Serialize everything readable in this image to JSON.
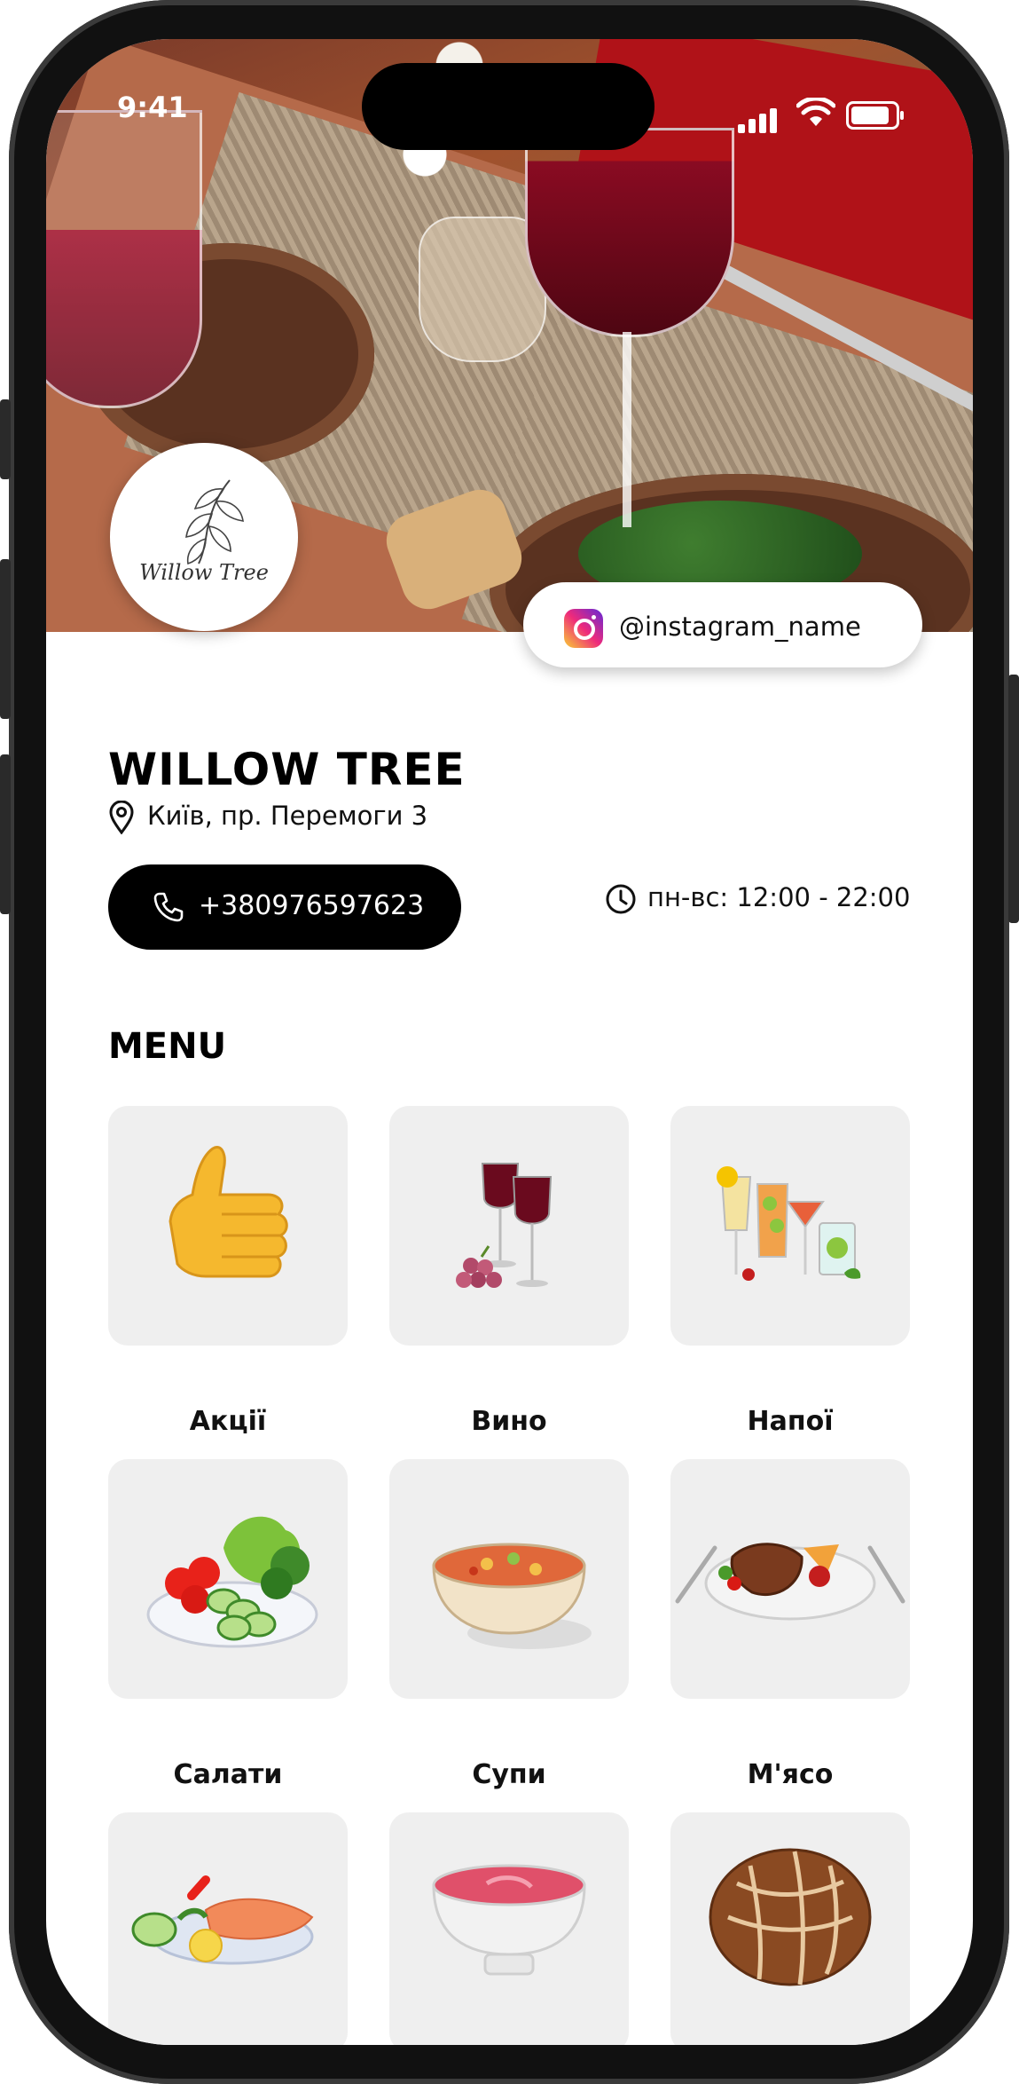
{
  "status_bar": {
    "time": "9:41"
  },
  "instagram": {
    "handle": "@instagram_name"
  },
  "logo": {
    "text": "Willow Tree"
  },
  "restaurant": {
    "name": "WILLOW TREE",
    "address": "Київ, пр. Перемоги 3",
    "phone": "+380976597623",
    "hours": "пн-вс: 12:00 - 22:00"
  },
  "menu": {
    "heading": "MENU",
    "categories": [
      {
        "label": "Акції",
        "icon": "thumbs-up-icon"
      },
      {
        "label": "Вино",
        "icon": "wine-glasses-icon"
      },
      {
        "label": "Напої",
        "icon": "cocktails-icon"
      },
      {
        "label": "Салати",
        "icon": "salad-icon"
      },
      {
        "label": "Супи",
        "icon": "soup-bowl-icon"
      },
      {
        "label": "М'ясо",
        "icon": "steak-icon"
      },
      {
        "label": "",
        "icon": "fish-icon"
      },
      {
        "label": "",
        "icon": "dessert-bowl-icon"
      },
      {
        "label": "",
        "icon": "bread-icon"
      }
    ]
  }
}
